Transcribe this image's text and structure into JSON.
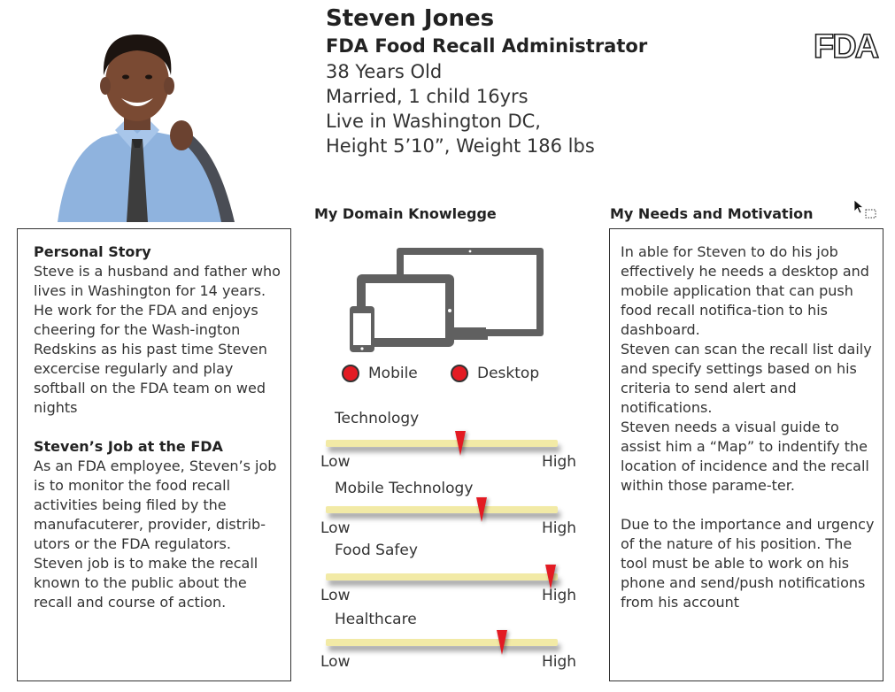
{
  "header": {
    "name": "Steven Jones",
    "role": "FDA Food Recall Administrator",
    "facts": [
      "38 Years Old",
      "Married, 1 child 16yrs",
      "Live in Washington DC,",
      "Height 5’10”, Weight 186 lbs"
    ],
    "logo_text": "FDA"
  },
  "personal": {
    "story_title": "Personal Story",
    "story_text": "Steve is a husband and father who lives in Washington for 14 years. He work for the FDA and enjoys cheering for the Wash-ington Redskins as his past time Steven excercise regularly and play softball on the FDA team on wed nights",
    "job_title": "Steven’s Job at the FDA",
    "job_text": "As an FDA employee, Steven’s job is to monitor the food recall activities being filed by the manufacuterer, provider, distrib-utors or the FDA regulators. Steven job is to make the recall known to the public about the recall and course of action."
  },
  "domain": {
    "heading": "My Domain Knowlegge",
    "legend": {
      "mobile": "Mobile",
      "desktop": "Desktop"
    },
    "low_label": "Low",
    "high_label": "High",
    "sliders": [
      {
        "label": "Technology",
        "level": 0.58
      },
      {
        "label": "Mobile Technology",
        "level": 0.67
      },
      {
        "label": "Food Safey",
        "level": 0.97
      },
      {
        "label": "Healthcare",
        "level": 0.76
      }
    ]
  },
  "needs": {
    "heading": "My Needs and Motivation",
    "para1": "In able for Steven to do his job effectively he needs a desktop and mobile application that can push food recall notifica-tion to his dashboard.",
    "para2": "Steven can scan the recall list daily and specify settings based on his criteria to send alert and notifications.",
    "para3": "Steven needs a visual guide to assist him a “Map” to indentify the location of incidence and the recall within those parame-ter.",
    "para4": "Due to the importance and urgency of the nature of his position. The tool must be able to work on his phone and send/push notifications from his account"
  },
  "colors": {
    "accent": "#e31b23",
    "track": "#f2eaa6",
    "device": "#606060"
  }
}
